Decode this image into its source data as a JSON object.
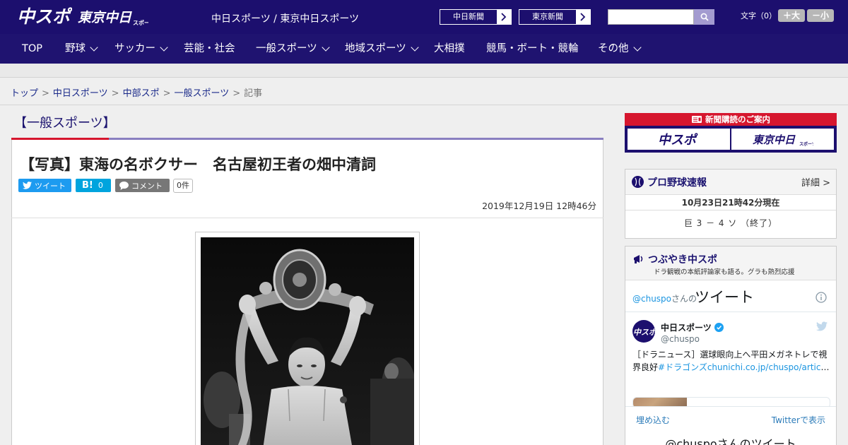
{
  "header": {
    "site_names": "中日スポーツ / 東京中日スポーツ",
    "paper_buttons": [
      {
        "label": "中日新聞"
      },
      {
        "label": "東京新聞"
      }
    ],
    "search": {
      "placeholder": "",
      "value": ""
    },
    "font_size_label": "文字（0）",
    "font_larger": "＋大",
    "font_smaller": "－小"
  },
  "nav": {
    "items": [
      {
        "label": "TOP"
      },
      {
        "label": "野球"
      },
      {
        "label": "サッカー"
      },
      {
        "label": "芸能・社会"
      },
      {
        "label": "一般スポーツ"
      },
      {
        "label": "地域スポーツ"
      },
      {
        "label": "大相撲"
      },
      {
        "label": "競馬・ボート・競輪"
      },
      {
        "label": "その他"
      }
    ]
  },
  "breadcrumb": {
    "items": [
      "トップ",
      "中日スポーツ",
      "中部スポ",
      "一般スポーツ"
    ],
    "current": "記事",
    "separator": ">"
  },
  "article": {
    "category": "【一般スポーツ】",
    "title": "【写真】東海の名ボクサー　名古屋初王者の畑中清詞",
    "tweet_label": "ツイート",
    "hatena_label": "B!",
    "hatena_count": "0",
    "comment_label": "コメント",
    "comment_count": "0件",
    "date": "2019年12月19日 12時46分"
  },
  "sidebar": {
    "subscribe_title": "新聞購読のご案内",
    "baseball": {
      "title": "プロ野球速報",
      "detail_link": "詳細 >",
      "updated": "10月23日21時42分現在",
      "score": "巨 3 － 4 ソ （終了）"
    },
    "tweets": {
      "title": "つぶやき中スポ",
      "subtitle": "ドラ観戦の本紙評論家も語る。グラも熱烈応援",
      "handle": "@chuspo",
      "handle_suffix": "さんの",
      "heading": "ツイート",
      "account_name": "中日スポーツ",
      "account_at": "@chuspo",
      "text_line1": "［ドラニュース］選球眼向上へ平田メガネトレで視",
      "text_line2_plain": "界良好",
      "text_line2_link": "#ドラゴンズchunichi.co.jp/chuspo/article…",
      "embed_link": "埋め込む",
      "view_link": "Twitterで表示",
      "more_text": "@chuspoさんのツイート"
    }
  },
  "colors": {
    "header_bg": "#1c0f6e",
    "nav_bg": "#1f1370",
    "accent_red": "#d6162e",
    "accent_purple": "#8a7fc0",
    "twitter_blue": "#1d9bf0",
    "hatena_blue": "#00a4de"
  },
  "icons": [
    "search-icon",
    "chevron-right-icon",
    "chevron-down-icon",
    "twitter-bird-icon",
    "hatena-icon",
    "comment-icon",
    "baseball-icon",
    "megaphone-icon",
    "info-icon",
    "verified-icon",
    "newspaper-icon"
  ]
}
